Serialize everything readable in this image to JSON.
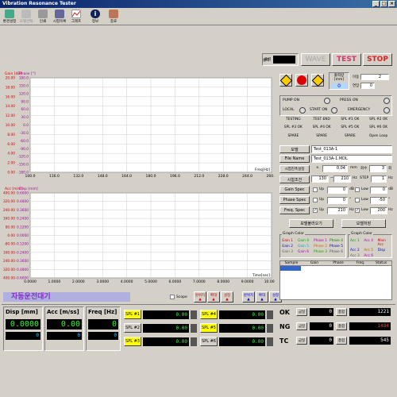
{
  "window": {
    "title": "Vibration Resonance Tester"
  },
  "toolbar": {
    "items": [
      {
        "label": "환경설정",
        "color": "#3a7"
      },
      {
        "label": "모델선택",
        "color": "#aaa"
      },
      {
        "label": "인쇄",
        "color": "#889"
      },
      {
        "label": "시험목록",
        "color": "#557"
      },
      {
        "label": "그래프",
        "color": "#c44"
      },
      {
        "label": "정보",
        "color": "#114"
      },
      {
        "label": "종료",
        "color": "#a64"
      }
    ]
  },
  "top_status": {
    "output_label": "출력",
    "wave": "WAVE",
    "test": "TEST",
    "stop": "STOP"
  },
  "top_chart": {
    "series_labels": [
      "Gain [dB]",
      "Phase [°]"
    ],
    "gain_ticks": [
      "20.00",
      "18.00",
      "16.00",
      "14.00",
      "12.00",
      "10.00",
      "8.00",
      "6.00",
      "4.00",
      "2.00",
      "0.00"
    ],
    "phase_ticks": [
      "180.0",
      "150.0",
      "120.0",
      "90.0",
      "60.0",
      "30.0",
      "0.0",
      "-30.0",
      "-60.0",
      "-90.0",
      "-120.0",
      "-150.0",
      "-180.0"
    ],
    "x_ticks": [
      "100.0",
      "116.0",
      "132.0",
      "148.0",
      "164.0",
      "180.0",
      "196.0",
      "212.0",
      "228.0",
      "244.0",
      "260.0"
    ],
    "x_label": "Freq[Hz]"
  },
  "bottom_chart": {
    "series_labels": [
      "Acc [m/s²]",
      "Disp [mm]"
    ],
    "acc_ticks": [
      "400.00",
      "320.00",
      "240.00",
      "160.00",
      "80.00",
      "0.00",
      "-80.00",
      "-160.00",
      "-240.00",
      "-320.00",
      "-400.00"
    ],
    "disp_ticks": [
      "0.6000",
      "0.4800",
      "0.3600",
      "0.2400",
      "0.1200",
      "0.0000",
      "-0.1200",
      "-0.2400",
      "-0.3600",
      "-0.4800",
      "-0.6000"
    ],
    "x_ticks": [
      "0.0000",
      "1.0000",
      "2.0000",
      "3.0000",
      "4.0000",
      "5.0000",
      "6.0000",
      "7.0000",
      "8.0000",
      "9.0000",
      "10.0000"
    ],
    "x_label": "Time[sec]"
  },
  "status_banner": "자동운전대기",
  "scope_label": "Scope",
  "zoom_controls": [
    "원위치",
    "확대",
    "설정",
    "원위치",
    "확대",
    "설정"
  ],
  "readouts": {
    "disp": {
      "label": "Disp [mm]",
      "value": "0.0000",
      "sub": "0"
    },
    "acc": {
      "label": "Acc [m/ss]",
      "value": "0.00",
      "sub": "0"
    },
    "freq": {
      "label": "Freq [Hz]",
      "value": "0",
      "sub": "0"
    }
  },
  "spl": [
    {
      "label": "SPL #1",
      "value": "0.00",
      "color": "#ff0"
    },
    {
      "label": "SPL #4",
      "value": "0.00",
      "color": "#ff0"
    },
    {
      "label": "SPL #2",
      "value": "0.00",
      "color": "#ddd"
    },
    {
      "label": "SPL #5",
      "value": "0.00",
      "color": "#ff0"
    },
    {
      "label": "SPL #3",
      "value": "0.00",
      "color": "#ff0"
    },
    {
      "label": "SPL #6",
      "value": "0.00",
      "color": "#ddd"
    }
  ],
  "right_panel": {
    "output_mm_label": "출력량[mm]",
    "output_mm_value": "0",
    "gain_label": "이동",
    "gain_value": "2",
    "phase_label": "연장",
    "phase_value": "0",
    "status_rows": [
      [
        "PUMP ON",
        "PRESS ON"
      ],
      [
        "LOCAL",
        "START ON",
        "EMERGENCY"
      ]
    ],
    "flags": [
      [
        "TESTING",
        "TEST END",
        "SPL #1 OK",
        "SPL #2 OK"
      ],
      [
        "SPL #3 OK",
        "SPL #4 OK",
        "SPL #5 OK",
        "SPL #6 OK"
      ],
      [
        "SPARE",
        "SPARE",
        "SPARE",
        "Open Loop"
      ]
    ],
    "model_label": "모델",
    "model_value": "Test_013A-1",
    "file_label": "File Name",
    "file_value": "Test_013A-1.MDL",
    "amp_label": "시험진폭설정",
    "amp_sign": "±",
    "amp_value": "0.04",
    "amp_unit": "mm",
    "count_label": "회수",
    "count_value": "3",
    "count_unit": "회",
    "cond_label": "시험조건",
    "cond_from": "130",
    "cond_to": "210",
    "cond_unit": "Hz",
    "step_label": "STEP",
    "step_value": "1",
    "step_unit": "Hz",
    "specs": [
      {
        "label": "Gain Spec",
        "up": "Up",
        "up_val": "0",
        "low": "Low",
        "low_val": "0"
      },
      {
        "label": "Phase Spec",
        "up": "Up",
        "up_val": "0",
        "low": "Low",
        "low_val": "-50"
      },
      {
        "label": "Freq. Spec",
        "up": "Up",
        "up_val": "210",
        "low": "Low",
        "low_val": "200"
      }
    ],
    "spec_units": [
      "dB",
      "dB",
      "°",
      "°",
      "Hz",
      "Hz"
    ],
    "load_btn": "모델불러오기",
    "save_btn": "모델저장",
    "graph_color1_title": "Graph Color",
    "graph_color1": [
      [
        {
          "t": "Gain 1",
          "c": "#c00"
        },
        {
          "t": "Gain 4",
          "c": "#0a0"
        },
        {
          "t": "Phase 1",
          "c": "#a0a"
        },
        {
          "t": "Phase 4",
          "c": "#080"
        }
      ],
      [
        {
          "t": "Gain 2",
          "c": "#00c"
        },
        {
          "t": "Gain 5",
          "c": "#0aa"
        },
        {
          "t": "Phase 2",
          "c": "#c60"
        },
        {
          "t": "Phase 5",
          "c": "#00a"
        }
      ],
      [
        {
          "t": "Gain 3",
          "c": "#666"
        },
        {
          "t": "Gain 6",
          "c": "#a0a"
        },
        {
          "t": "Phase 3",
          "c": "#0a0"
        },
        {
          "t": "Phase 6",
          "c": "#555"
        }
      ]
    ],
    "graph_color2_title": "Graph Color",
    "graph_color2": [
      [
        {
          "t": "Acc 1",
          "c": "#090"
        },
        {
          "t": "Acc 4",
          "c": "#a0a"
        },
        {
          "t": "Main Acc",
          "c": "#c00"
        }
      ],
      [
        {
          "t": "Acc 2",
          "c": "#00c"
        },
        {
          "t": "Acc 5",
          "c": "#a60"
        },
        {
          "t": "Disp",
          "c": "#00a"
        }
      ],
      [
        {
          "t": "Acc 3",
          "c": "#666"
        },
        {
          "t": "Acc 6",
          "c": "#a0a"
        }
      ]
    ],
    "table_headers": [
      "Sample",
      "Gain",
      "Phase",
      "Freq.",
      "Status"
    ]
  },
  "counters": [
    {
      "label": "OK",
      "sub": "금일",
      "v1": "0",
      "total": "총합",
      "v2": "1221",
      "c2": "#fff"
    },
    {
      "label": "NG",
      "sub": "금일",
      "v1": "0",
      "total": "총합",
      "v2": "1484",
      "c2": "#f33"
    },
    {
      "label": "TC",
      "sub": "금일",
      "v1": "0",
      "total": "총합",
      "v2": "545",
      "c2": "#fff"
    }
  ]
}
